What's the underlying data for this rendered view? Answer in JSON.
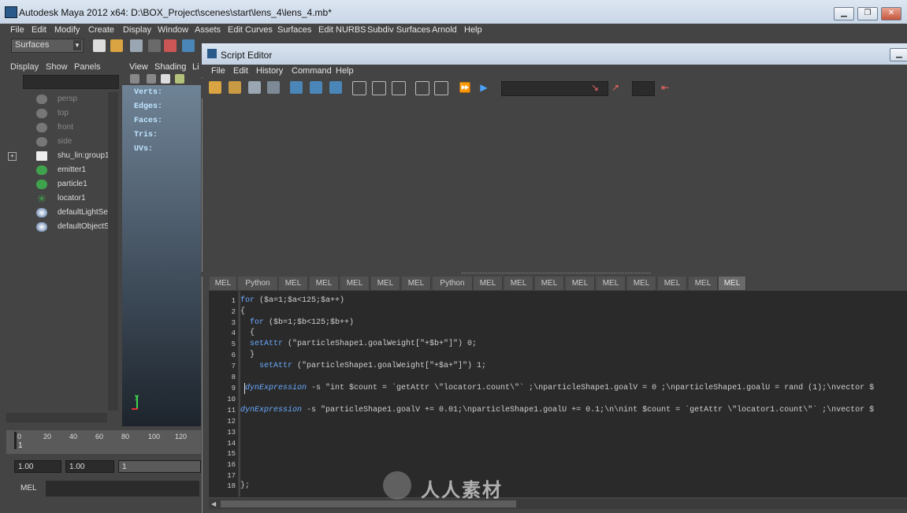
{
  "maya": {
    "title": "Autodesk Maya 2012 x64: D:\\BOX_Project\\scenes\\start\\lens_4\\lens_4.mb*",
    "menu": [
      "File",
      "Edit",
      "Modify",
      "Create",
      "Display",
      "Window",
      "Assets",
      "Edit Curves",
      "Surfaces",
      "Edit NURBS",
      "Subdiv Surfaces",
      "Arnold",
      "Help"
    ],
    "menuset": "Surfaces",
    "outliner_menu": [
      "Display",
      "Show",
      "Panels"
    ],
    "viewport_menu": [
      "View",
      "Shading",
      "Li"
    ],
    "outliner_items": [
      {
        "label": "persp",
        "dim": true
      },
      {
        "label": "top",
        "dim": true
      },
      {
        "label": "front",
        "dim": true
      },
      {
        "label": "side",
        "dim": true
      },
      {
        "label": "shu_lin:group1",
        "dim": false
      },
      {
        "label": "emitter1",
        "dim": false
      },
      {
        "label": "particle1",
        "dim": false
      },
      {
        "label": "locator1",
        "dim": false
      },
      {
        "label": "defaultLightSe",
        "dim": false
      },
      {
        "label": "defaultObjectS",
        "dim": false
      }
    ],
    "hud": [
      "Verts:",
      "Edges:",
      "Faces:",
      "Tris:",
      "UVs:"
    ],
    "timeline_ticks": [
      "0",
      "20",
      "40",
      "60",
      "80",
      "100",
      "120"
    ],
    "current_frame": "1",
    "range_start": "1.00",
    "range_start2": "1.00",
    "range_field": "1",
    "cmd_language": "MEL"
  },
  "script_editor": {
    "title": "Script Editor",
    "menu": [
      "File",
      "Edit",
      "History",
      "Command",
      "Help"
    ],
    "tabs": [
      "MEL",
      "Python",
      "MEL",
      "MEL",
      "MEL",
      "MEL",
      "MEL",
      "Python",
      "MEL",
      "MEL",
      "MEL",
      "MEL",
      "MEL",
      "MEL",
      "MEL",
      "MEL",
      "MEL"
    ],
    "active_tab": 16,
    "line_numbers": [
      "1",
      "2",
      "3",
      "4",
      "5",
      "6",
      "7",
      "8",
      "9",
      "10",
      "11",
      "12",
      "13",
      "14",
      "15",
      "16",
      "17",
      "18"
    ],
    "code": {
      "l1_kw": "for",
      "l1_rest": " ($a=1;$a<125;$a++)",
      "l2": "{",
      "l3_kw": "  for",
      "l3_rest": " ($b=1;$b<125;$b++)",
      "l4": "  {",
      "l5_fn": "  setAttr",
      "l5_rest": " (\"particleShape1.goalWeight[\"+$b+\"]\") 0;",
      "l6": "  }",
      "l7_fn": "    setAttr",
      "l7_rest": " (\"particleShape1.goalWeight[\"+$a+\"]\") 1;",
      "l9_fn": "dynExpression",
      "l9_rest": " -s \"int $count = `getAttr \\\"locator1.count\\\"` ;\\nparticleShape1.goalV = 0 ;\\nparticleShape1.goalU = rand (1);\\nvector $",
      "l11_fn": "dynExpression",
      "l11_rest": " -s \"particleShape1.goalV += 0.01;\\nparticleShape1.goalU += 0.1;\\n\\nint $count = `getAttr \\\"locator1.count\\\"` ;\\nvector $",
      "l18": "};"
    }
  },
  "watermark": "人人素材",
  "colors": {
    "code_keyword": "#6aa9ff",
    "editor_bg": "#2a2a2a",
    "panel_bg": "#444444"
  }
}
